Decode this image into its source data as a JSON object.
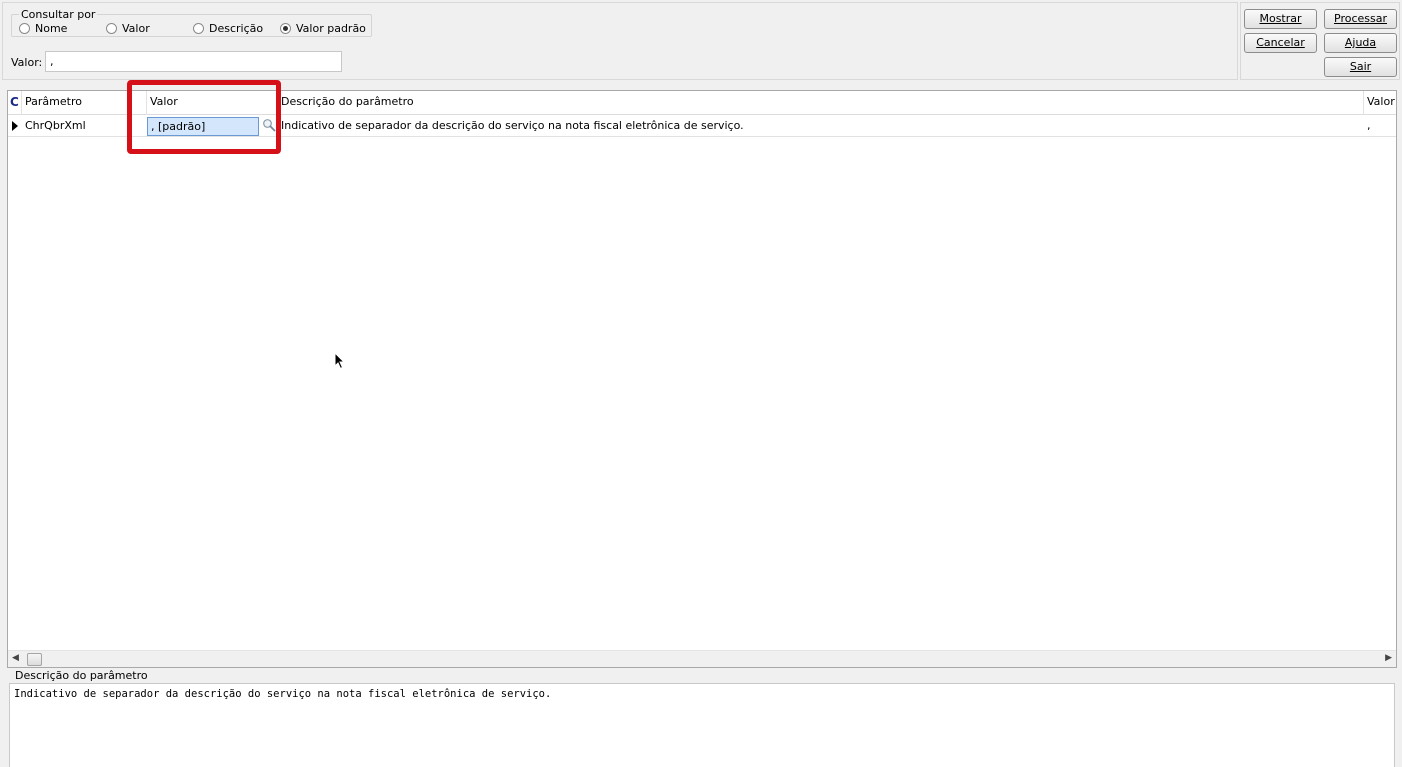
{
  "consultar": {
    "title": "Consultar por",
    "options": [
      "Nome",
      "Valor",
      "Descrição",
      "Valor padrão"
    ],
    "selected": "Valor padrão",
    "valor_label": "Valor:",
    "valor_value": ","
  },
  "buttons": {
    "mostrar": "Mostrar",
    "processar": "Processar",
    "cancelar": "Cancelar",
    "ajuda": "Ajuda",
    "sair": "Sair"
  },
  "grid": {
    "columns": [
      "C",
      "Parâmetro",
      "Valor",
      "Descrição do parâmetro",
      "Valor"
    ],
    "rows": [
      {
        "parametro": "ChrQbrXml",
        "valor": ", [padrão]",
        "descricao": "Indicativo de separador da descrição do serviço na nota fiscal eletrônica de serviço.",
        "valor_padrao": ","
      }
    ]
  },
  "description_panel": {
    "title": "Descrição do parâmetro",
    "text": "Indicativo de separador da descrição do serviço na nota fiscal eletrônica de serviço."
  },
  "colors": {
    "highlight": "#d51019",
    "editor_bg": "#d4e6fb"
  }
}
